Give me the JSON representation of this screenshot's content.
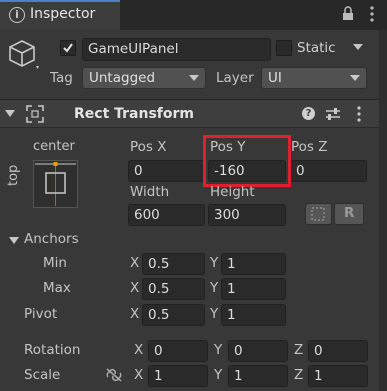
{
  "tab": {
    "title": "Inspector"
  },
  "object": {
    "name": "GameUIPanel",
    "active": true,
    "static_label": "Static",
    "static_checked": false
  },
  "tag": {
    "label": "Tag",
    "value": "Untagged"
  },
  "layer": {
    "label": "Layer",
    "value": "UI"
  },
  "component": {
    "title": "Rect Transform"
  },
  "anchor_preset": {
    "h_label": "center",
    "v_label": "top"
  },
  "position": {
    "pos_x_label": "Pos X",
    "pos_x": "0",
    "pos_y_label": "Pos Y",
    "pos_y": "-160",
    "pos_z_label": "Pos Z",
    "pos_z": "0",
    "width_label": "Width",
    "width": "600",
    "height_label": "Height",
    "height": "300",
    "r_label": "R"
  },
  "anchors": {
    "label": "Anchors",
    "min_label": "Min",
    "min_x": "0.5",
    "min_y": "1",
    "max_label": "Max",
    "max_x": "0.5",
    "max_y": "1"
  },
  "pivot": {
    "label": "Pivot",
    "x": "0.5",
    "y": "1"
  },
  "rotation": {
    "label": "Rotation",
    "x": "0",
    "y": "0",
    "z": "0"
  },
  "scale": {
    "label": "Scale",
    "x": "1",
    "y": "1",
    "z": "1"
  },
  "axis": {
    "x": "X",
    "y": "Y",
    "z": "Z"
  },
  "colors": {
    "highlight": "#e0202a",
    "background": "#383838",
    "field": "#2a2a2a"
  }
}
